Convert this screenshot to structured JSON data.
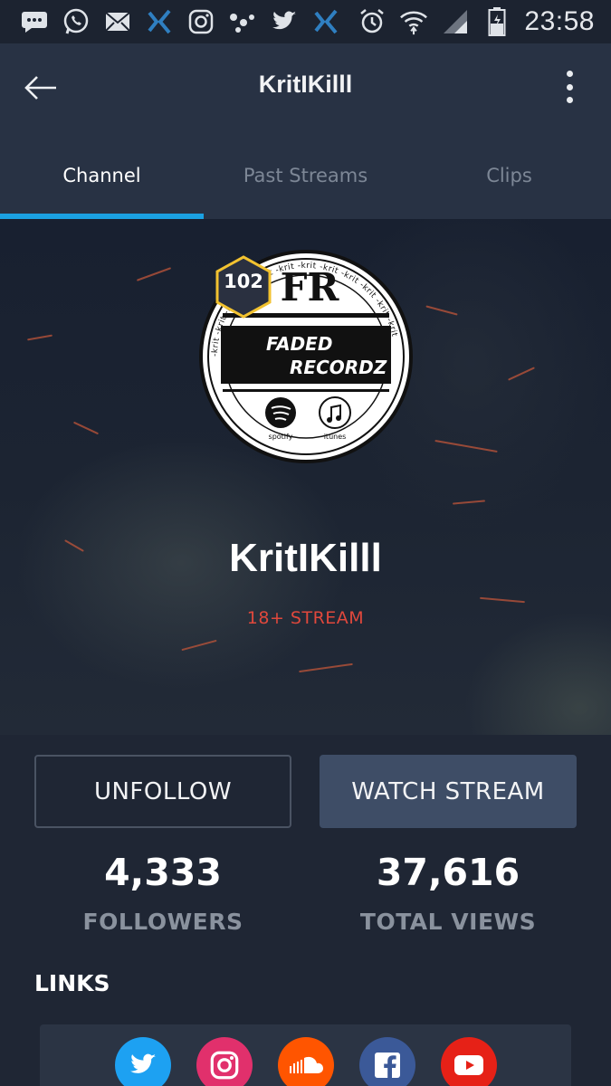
{
  "status_bar": {
    "time": "23:58",
    "left_icons": [
      "chat-bubble-icon",
      "whatsapp-icon",
      "mail-icon",
      "xing-icon",
      "instagram-icon",
      "dots-app-icon",
      "twitter-icon",
      "xing-icon"
    ],
    "right_icons": [
      "alarm-icon",
      "wifi-icon",
      "signal-icon",
      "battery-icon"
    ]
  },
  "app_bar": {
    "title": "KritIKilll",
    "back_icon": "arrow-left-icon",
    "menu_icon": "more-vert-icon"
  },
  "tabs": [
    {
      "label": "Channel",
      "active": true
    },
    {
      "label": "Past Streams",
      "active": false
    },
    {
      "label": "Clips",
      "active": false
    }
  ],
  "channel": {
    "name": "KritIKilll",
    "level": "102",
    "mature_tag": "18+ STREAM",
    "avatar": {
      "monogram": "FR",
      "logo_line1": "FADED",
      "logo_line2": "RECORDZ",
      "ring_text": "-krit -krit -krit -krit -krit -krit -krit -krit -krit -krit -krit -krit",
      "badge1_label": "spotify",
      "badge2_label": "itunes"
    }
  },
  "actions": {
    "unfollow_label": "UNFOLLOW",
    "watch_label": "WATCH STREAM"
  },
  "stats": {
    "followers_value": "4,333",
    "followers_label": "FOLLOWERS",
    "views_value": "37,616",
    "views_label": "TOTAL VIEWS"
  },
  "links": {
    "heading": "LINKS",
    "items": [
      {
        "icon": "twitter-icon",
        "color": "#1da1f2"
      },
      {
        "icon": "instagram-icon",
        "color": "#e1306c"
      },
      {
        "icon": "soundcloud-icon",
        "color": "#ff5500"
      },
      {
        "icon": "facebook-icon",
        "color": "#3b5998"
      },
      {
        "icon": "youtube-icon",
        "color": "#e62117"
      }
    ]
  },
  "colors": {
    "accent": "#1ba1e2",
    "mature": "#e0483c",
    "background": "#1f2634",
    "app_bar": "#283244"
  }
}
